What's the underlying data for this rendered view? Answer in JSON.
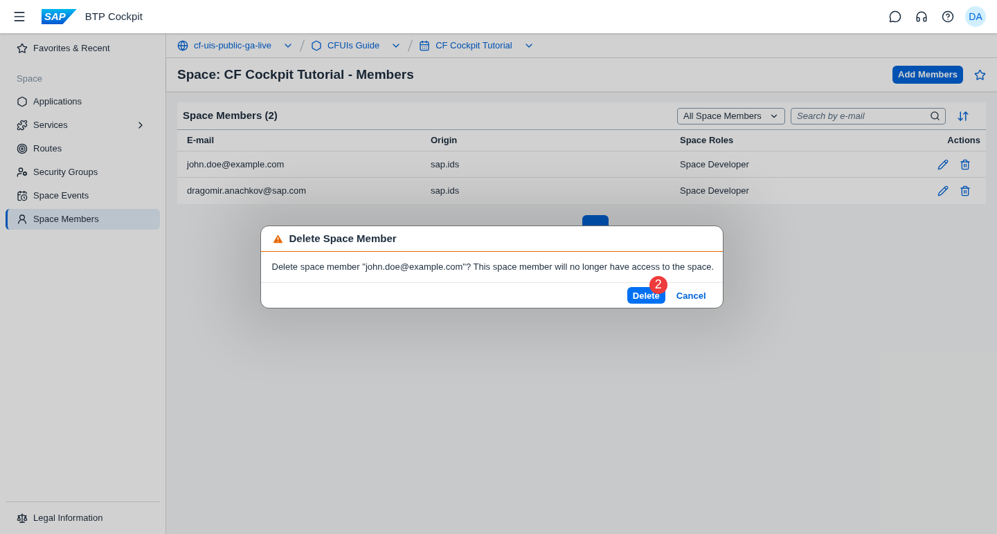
{
  "header": {
    "logo": "SAP",
    "title": "BTP Cockpit",
    "avatar": "DA"
  },
  "sidebar": {
    "top_item": {
      "label": "Favorites & Recent",
      "selected": false
    },
    "section": "Space",
    "items": [
      {
        "label": "Applications",
        "selected": false,
        "has_submenu": false
      },
      {
        "label": "Services",
        "selected": false,
        "has_submenu": true
      },
      {
        "label": "Routes",
        "selected": false,
        "has_submenu": false
      },
      {
        "label": "Security Groups",
        "selected": false,
        "has_submenu": false
      },
      {
        "label": "Space Events",
        "selected": false,
        "has_submenu": false
      },
      {
        "label": "Space Members",
        "selected": true,
        "has_submenu": false
      }
    ],
    "footer_item": "Legal Information"
  },
  "breadcrumbs": [
    {
      "label": "cf-uis-public-ga-live"
    },
    {
      "label": "CFUIs Guide"
    },
    {
      "label": "CF Cockpit Tutorial"
    }
  ],
  "page": {
    "title": "Space: CF Cockpit Tutorial - Members",
    "primary_action": "Add Members"
  },
  "table": {
    "title": "Space Members (2)",
    "filter": "All Space Members",
    "search": {
      "placeholder": "Search by e-mail"
    },
    "columns": [
      "E-mail",
      "Origin",
      "Space Roles",
      "Actions"
    ],
    "rows": [
      [
        "john.doe@example.com",
        "sap.ids",
        "Space Developer"
      ],
      [
        "dragomir.anachkov@sap.com",
        "sap.ids",
        "Space Developer"
      ]
    ]
  },
  "dialog": {
    "title": "Delete Space Member",
    "message": "Delete space member \"john.doe@example.com\"? This space member will no longer have access to the space.",
    "buttons": [
      {
        "label": "Delete",
        "kind": "primary"
      },
      {
        "label": "Cancel",
        "kind": "transparent"
      }
    ],
    "step_badge": "2"
  }
}
